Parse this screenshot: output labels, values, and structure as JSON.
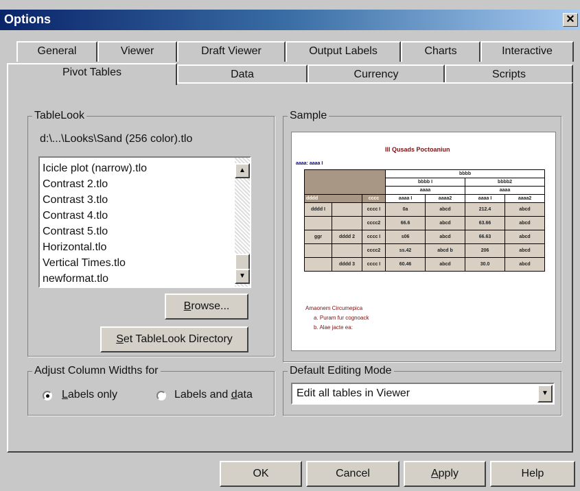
{
  "window": {
    "title": "Options",
    "close_glyph": "✕"
  },
  "tabs_row1": [
    "General",
    "Viewer",
    "Draft Viewer",
    "Output Labels",
    "Charts",
    "Interactive"
  ],
  "tabs_row2": [
    "Pivot Tables",
    "Data",
    "Currency",
    "Scripts"
  ],
  "active_tab": "Pivot Tables",
  "tablelook": {
    "legend": "TableLook",
    "path": "d:\\...\\Looks\\Sand (256 color).tlo",
    "items": [
      "Icicle plot (narrow).tlo",
      "Contrast 2.tlo",
      "Contrast 3.tlo",
      "Contrast 4.tlo",
      "Contrast 5.tlo",
      "Horizontal.tlo",
      "Vertical Times.tlo",
      "newformat.tlo"
    ],
    "browse_pre": "",
    "browse_key": "B",
    "browse_post": "rowse...",
    "setdir_pre": "",
    "setdir_key": "S",
    "setdir_post": "et TableLook Directory"
  },
  "sample": {
    "legend": "Sample",
    "title": "Ill Qusads Poctoaniun",
    "tag": "aaaa: aaaa I",
    "footnote_title": "Amaonem Circumepica",
    "footnote_a": "a. Puram fur cognoack",
    "footnote_b": "b. Alae jacte ea:",
    "header_main": "bbbb",
    "header_sub1": "bbbb I",
    "header_sub2": "bbbb2",
    "header_aaaa": "aaaa",
    "col_labels": [
      "aaaa I",
      "aaaa2",
      "aaaa I",
      "aaaa2"
    ],
    "row_dims": [
      "dddd",
      "cccc"
    ],
    "rows": [
      [
        "dddd I",
        "",
        "cccc I",
        "0a",
        "abcd",
        "212.4",
        "abcd"
      ],
      [
        "",
        "",
        "cccc2",
        "66.6",
        "abcd",
        "63.66",
        "abcd"
      ],
      [
        "ggr",
        "dddd 2",
        "cccc I",
        "s06",
        "abcd",
        "66.63",
        "abcd"
      ],
      [
        "",
        "",
        "cccc2",
        "ss.42",
        "abcd b",
        "206",
        "abcd"
      ],
      [
        "",
        "dddd 3",
        "cccc I",
        "60.46",
        "abcd",
        "30.0",
        "abcd"
      ]
    ]
  },
  "adjust": {
    "legend": "Adjust Column Widths for",
    "opt1_pre": "",
    "opt1_key": "L",
    "opt1_post": "abels only",
    "opt2_pre": "Labels and ",
    "opt2_key": "d",
    "opt2_post": "ata",
    "selected": "Labels only"
  },
  "editing": {
    "legend": "Default Editing Mode",
    "value": "Edit all tables in Viewer"
  },
  "footer": {
    "ok": "OK",
    "cancel": "Cancel",
    "apply_pre": "",
    "apply_key": "A",
    "apply_post": "pply",
    "help": "Help"
  }
}
